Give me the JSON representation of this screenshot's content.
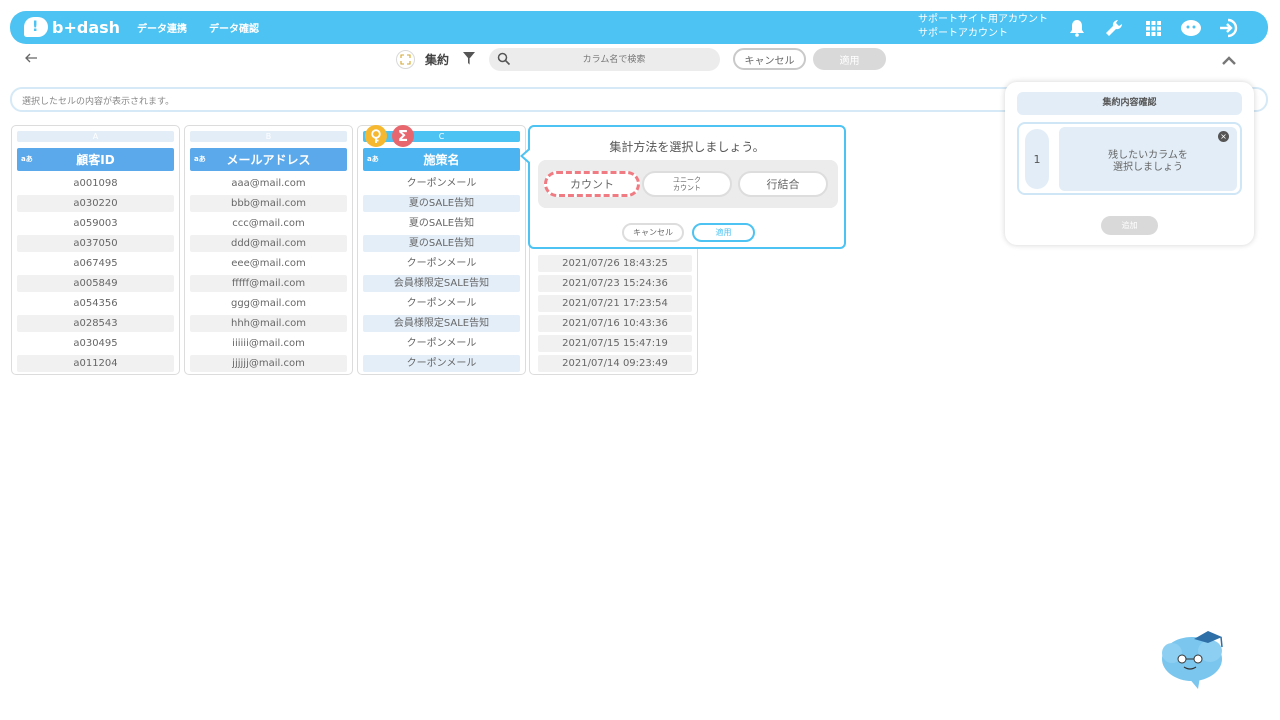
{
  "nav": {
    "logo_text": "b+dash",
    "links": [
      "データ連携",
      "データ確認"
    ],
    "account_line1": "サポートサイト用アカウント",
    "account_line2": "サポートアカウント"
  },
  "toolbar": {
    "mode_label": "集約",
    "search_placeholder": "カラム名で検索",
    "cancel_label": "キャンセル",
    "apply_label": "適用"
  },
  "cell_bar": {
    "placeholder": "選択したセルの内容が表示されます。"
  },
  "columns": [
    {
      "letter": "A",
      "type": "aあ",
      "header": "顧客ID",
      "cells": [
        "a001098",
        "a030220",
        "a059003",
        "a037050",
        "a067495",
        "a005849",
        "a054356",
        "a028543",
        "a030495",
        "a011204"
      ]
    },
    {
      "letter": "B",
      "type": "aあ",
      "header": "メールアドレス",
      "cells": [
        "aaa@mail.com",
        "bbb@mail.com",
        "ccc@mail.com",
        "ddd@mail.com",
        "eee@mail.com",
        "fffff@mail.com",
        "ggg@mail.com",
        "hhh@mail.com",
        "iiiiii@mail.com",
        "jjjjjj@mail.com"
      ]
    },
    {
      "letter": "C",
      "type": "aあ",
      "header": "施策名",
      "cells": [
        "クーポンメール",
        "夏のSALE告知",
        "夏のSALE告知",
        "夏のSALE告知",
        "クーポンメール",
        "会員様限定SALE告知",
        "クーポンメール",
        "会員様限定SALE告知",
        "クーポンメール",
        "クーポンメール"
      ]
    },
    {
      "cells": [
        "2021/07/26 18:43:25",
        "2021/07/23 15:24:36",
        "2021/07/21 17:23:54",
        "2021/07/16 10:43:36",
        "2021/07/15 15:47:19",
        "2021/07/14 09:23:49"
      ]
    }
  ],
  "popup": {
    "title": "集計方法を選択しましょう。",
    "methods": [
      "カウント",
      "ユニーク\nカウント",
      "行結合"
    ],
    "cancel_label": "キャンセル",
    "apply_label": "適用"
  },
  "side_panel": {
    "title": "集約内容確認",
    "row_number": "1",
    "slot_text": "残したいカラムを\n選択しましょう",
    "add_label": "追加"
  },
  "colors": {
    "accent": "#4cc3f2",
    "header_blue": "#5ba9ea",
    "selected_dash": "#f07b82",
    "key_badge": "#f5b82e",
    "sigma_badge": "#e8666e"
  }
}
